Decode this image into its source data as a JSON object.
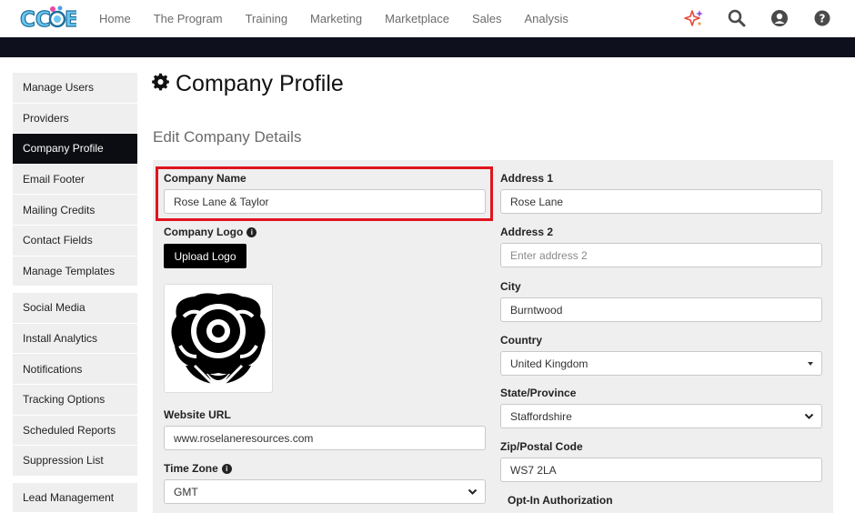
{
  "app": {
    "logo_text": "CCOE"
  },
  "nav": {
    "links": [
      "Home",
      "The Program",
      "Training",
      "Marketing",
      "Marketplace",
      "Sales",
      "Analysis"
    ]
  },
  "sidebar": {
    "groups": [
      [
        "Manage Users",
        "Providers",
        "Company Profile",
        "Email Footer",
        "Mailing Credits",
        "Contact Fields",
        "Manage Templates"
      ],
      [
        "Social Media",
        "Install Analytics",
        "Notifications",
        "Tracking Options",
        "Scheduled Reports",
        "Suppression List"
      ],
      [
        "Lead Management"
      ]
    ],
    "active": "Company Profile"
  },
  "page": {
    "title": "Company Profile",
    "subtitle": "Edit Company Details"
  },
  "form": {
    "company_name": {
      "label": "Company Name",
      "value": "Rose Lane & Taylor"
    },
    "company_logo": {
      "label": "Company Logo",
      "button": "Upload Logo"
    },
    "website_url": {
      "label": "Website URL",
      "value": "www.roselaneresources.com"
    },
    "time_zone": {
      "label": "Time Zone",
      "value": "GMT"
    },
    "address1": {
      "label": "Address 1",
      "value": "Rose Lane"
    },
    "address2": {
      "label": "Address 2",
      "placeholder": "Enter address 2"
    },
    "city": {
      "label": "City",
      "value": "Burntwood"
    },
    "country": {
      "label": "Country",
      "value": "United Kingdom"
    },
    "state": {
      "label": "State/Province",
      "value": "Staffordshire"
    },
    "zip": {
      "label": "Zip/Postal Code",
      "value": "WS7 2LA"
    },
    "opt_in": {
      "label": "Opt-In Authorization"
    }
  },
  "colors": {
    "highlight": "#e0141e",
    "active_bg": "#0b0d12",
    "topbar": "#0e111d"
  }
}
